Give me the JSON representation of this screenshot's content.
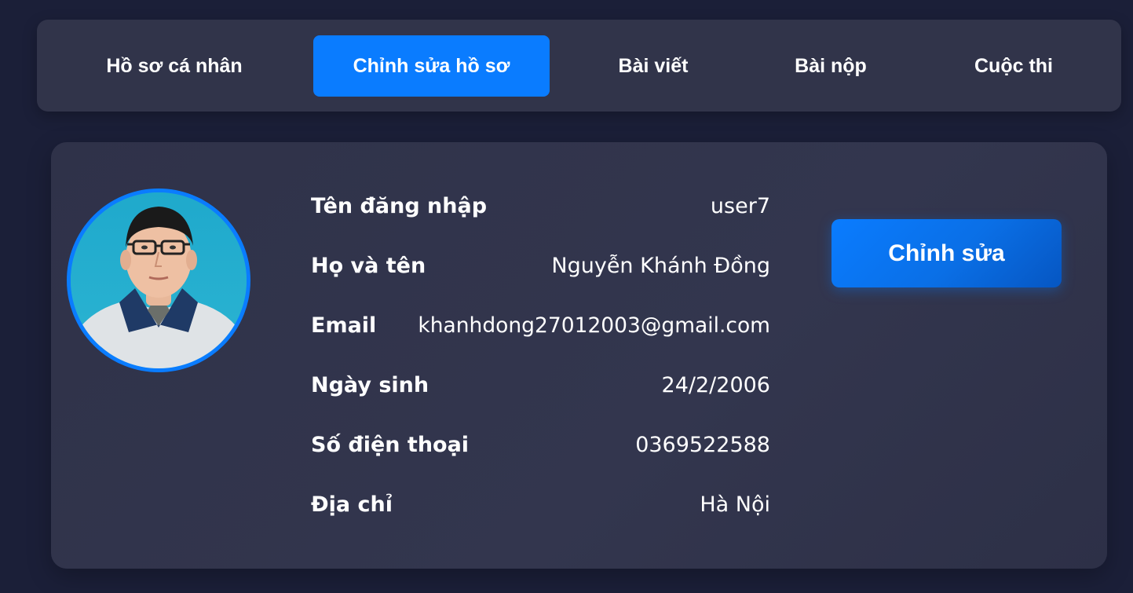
{
  "tabs": [
    {
      "label": "Hồ sơ cá nhân",
      "active": false
    },
    {
      "label": "Chỉnh sửa hồ sơ",
      "active": true
    },
    {
      "label": "Bài viết",
      "active": false
    },
    {
      "label": "Bài nộp",
      "active": false
    },
    {
      "label": "Cuộc thi",
      "active": false
    }
  ],
  "profile": {
    "fields": [
      {
        "label": "Tên đăng nhập",
        "value": "user7"
      },
      {
        "label": "Họ và tên",
        "value": "Nguyễn Khánh Đồng"
      },
      {
        "label": "Email",
        "value": "khanhdong27012003@gmail.com"
      },
      {
        "label": "Ngày sinh",
        "value": "24/2/2006"
      },
      {
        "label": "Số điện thoại",
        "value": "0369522588"
      },
      {
        "label": "Địa chỉ",
        "value": "Hà Nội"
      }
    ],
    "avatar_icon": "user-avatar-photo",
    "edit_label": "Chỉnh sửa"
  },
  "colors": {
    "background": "#1b1f38",
    "panel": "#31344a",
    "accent": "#0a7cff",
    "text": "#ffffff"
  }
}
